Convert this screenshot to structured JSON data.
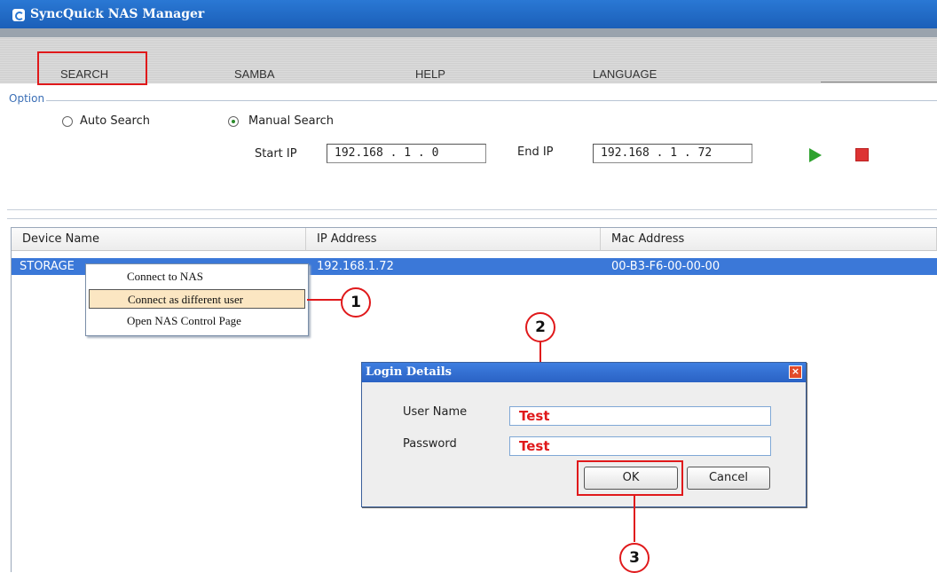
{
  "window": {
    "title": "SyncQuick NAS Manager"
  },
  "menu": {
    "search": "SEARCH",
    "samba": "SAMBA",
    "help": "HELP",
    "language": "LANGUAGE"
  },
  "option": {
    "legend": "Option",
    "auto_search": "Auto Search",
    "manual_search": "Manual Search",
    "selected_mode": "Manual Search",
    "start_ip_label": "Start IP",
    "start_ip_value": "192.168 . 1 . 0",
    "end_ip_label": "End IP",
    "end_ip_value": "192.168 . 1 . 72"
  },
  "table": {
    "columns": [
      "Device Name",
      "IP Address",
      "Mac Address"
    ],
    "rows": [
      {
        "device": "STORAGE",
        "ip": "192.168.1.72",
        "mac": "00-B3-F6-00-00-00"
      }
    ]
  },
  "context_menu": {
    "items": [
      "Connect to NAS",
      "Connect as different user",
      "Open NAS Control Page"
    ],
    "highlighted": "Connect as different user"
  },
  "dialog": {
    "title": "Login Details",
    "username_label": "User Name",
    "username_value": "Test",
    "password_label": "Password",
    "password_value": "Test",
    "ok_label": "OK",
    "cancel_label": "Cancel"
  },
  "callouts": [
    "1",
    "2",
    "3"
  ],
  "colors": {
    "accent": "#e0191b",
    "selection": "#3b78d8",
    "titlebar": "#1b5fb8"
  },
  "icons": {
    "app": "syncquick-app-icon",
    "play": "play-icon",
    "stop": "stop-icon",
    "close": "close-icon"
  }
}
